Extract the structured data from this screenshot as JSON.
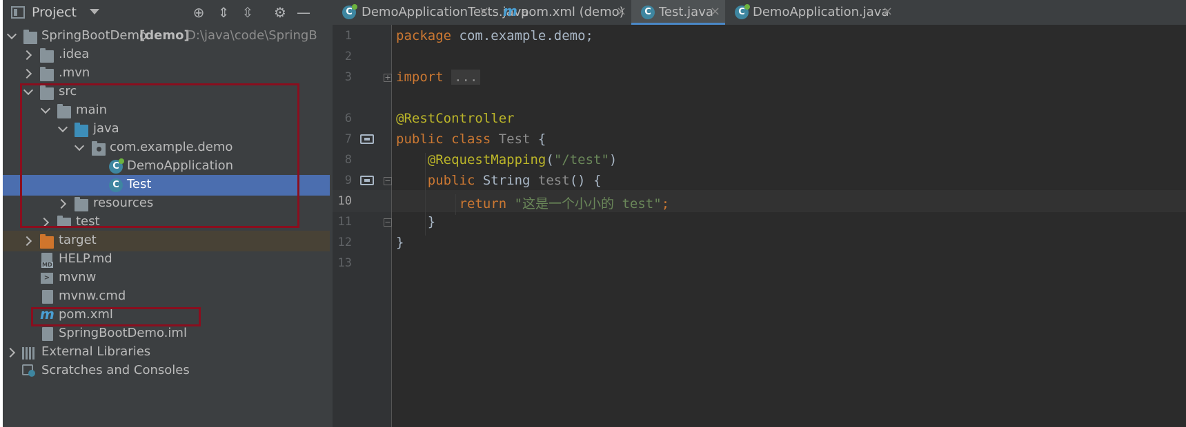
{
  "project_panel": {
    "title": "Project",
    "tree": [
      {
        "label": "SpringBootDemo",
        "suffix": "[demo]",
        "path": "D:\\java\\code\\SpringB"
      },
      {
        "label": ".idea"
      },
      {
        "label": ".mvn"
      },
      {
        "label": "src"
      },
      {
        "label": "main"
      },
      {
        "label": "java"
      },
      {
        "label": "com.example.demo"
      },
      {
        "label": "DemoApplication"
      },
      {
        "label": "Test"
      },
      {
        "label": "resources"
      },
      {
        "label": "test"
      },
      {
        "label": "target"
      },
      {
        "label": "HELP.md"
      },
      {
        "label": "mvnw"
      },
      {
        "label": "mvnw.cmd"
      },
      {
        "label": "pom.xml"
      },
      {
        "label": "SpringBootDemo.iml"
      },
      {
        "label": "External Libraries"
      },
      {
        "label": "Scratches and Consoles"
      }
    ]
  },
  "tabs": [
    {
      "label": "DemoApplicationTests.java",
      "active": false
    },
    {
      "label": "pom.xml (demo)",
      "active": false
    },
    {
      "label": "Test.java",
      "active": true
    },
    {
      "label": "DemoApplication.java",
      "active": false
    }
  ],
  "tab_close_glyph": "×",
  "mvn_glyph": "m",
  "class_glyph": "C",
  "editor": {
    "current_line": 10,
    "line_numbers": [
      "1",
      "2",
      "3",
      "6",
      "7",
      "8",
      "9",
      "10",
      "11",
      "12",
      "13"
    ],
    "code": {
      "l1_kw": "package",
      "l1_rest": " com.example.demo;",
      "l3_kw": "import",
      "l3_fold": "...",
      "l6_ann": "@RestController",
      "l7_kw": "public class",
      "l7_name": " Test",
      "l7_rest": " {",
      "l8_ann": "@RequestMapping",
      "l8_open": "(",
      "l8_str": "\"/test\"",
      "l8_close": ")",
      "l9_kw": "public",
      "l9_type": " String ",
      "l9_fn": "test",
      "l9_rest": "() {",
      "l10_kw": "return",
      "l10_str": "\"这是一个小小的 test\"",
      "l10_semi": ";",
      "l11": "}",
      "l12": "}"
    }
  }
}
